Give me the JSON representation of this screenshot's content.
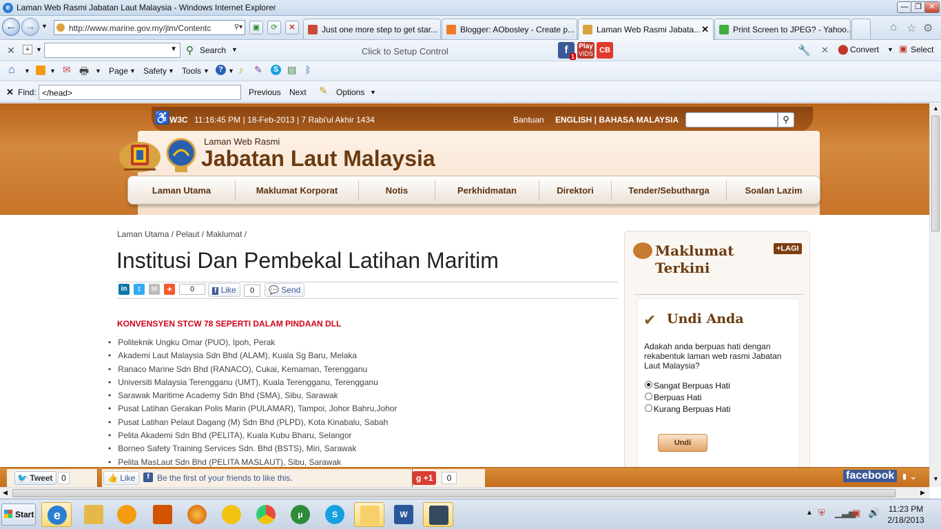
{
  "window": {
    "title": "Laman Web Rasmi Jabatan Laut Malaysia - Windows Internet Explorer"
  },
  "browser": {
    "url": "http://www.marine.gov.my/jlm/Contentc",
    "tabs": [
      {
        "label": "Just one more step to get star...",
        "color": "#c94a3a"
      },
      {
        "label": "Blogger: AObosley - Create p...",
        "color": "#f27b22"
      },
      {
        "label": "Laman Web Rasmi Jabata...",
        "color": "#d9a340"
      },
      {
        "label": "Print Screen to JPEG? - Yahoo...",
        "color": "#3fae3f"
      }
    ],
    "search_label": "Search",
    "utorrent": "uTorrent",
    "setup_control": "Click to Setup Control",
    "convert": "Convert",
    "select": "Select",
    "cmd": {
      "page": "Page",
      "safety": "Safety",
      "tools": "Tools"
    },
    "find": {
      "label": "Find:",
      "value": "</head>",
      "previous": "Previous",
      "next": "Next",
      "options": "Options"
    },
    "toolbar_badges": {
      "fb": "f",
      "fb_count": "1",
      "play": "Play",
      "vids": "VIDS",
      "cb": "CB"
    }
  },
  "site": {
    "topbar": {
      "w3c": "W3C",
      "datetime": "11:16:45 PM | 18-Feb-2013 | 7 Rabi'ul Akhir 1434",
      "help": "Bantuan",
      "lang": "ENGLISH | BAHASA MALAYSIA"
    },
    "logo_small": "Laman Web Rasmi",
    "logo_big": "Jabatan Laut Malaysia",
    "nav": [
      "Laman Utama",
      "Maklumat Korporat",
      "Notis",
      "Perkhidmatan",
      "Direktori",
      "Tender/Sebutharga",
      "Soalan Lazim"
    ],
    "breadcrumb": "Laman Utama / Pelaut / Maklumat /",
    "page_title": "Institusi Dan Pembekal Latihan Maritim",
    "share": {
      "count": "0",
      "like": "Like",
      "like_count": "0",
      "send": "Send"
    },
    "section_heading": "KONVENSYEN STCW 78 SEPERTI DALAM PINDAAN DLL",
    "institutions": [
      "Politeknik Ungku Omar (PUO), Ipoh, Perak",
      "Akademi Laut Malaysia Sdn Bhd (ALAM), Kuala Sg Baru, Melaka",
      "Ranaco Marine Sdn Bhd (RANACO), Cukai, Kemaman, Terengganu",
      "Universiti Malaysia Terengganu (UMT), Kuala Terengganu, Terengganu",
      "Sarawak Maritime Academy Sdn Bhd (SMA), Sibu, Sarawak",
      "Pusat Latihan Gerakan Polis Marin (PULAMAR), Tampoi, Johor Bahru,Johor",
      "Pusat Latihan Pelaut Dagang (M) Sdn Bhd (PLPD), Kota Kinabalu, Sabah",
      "Pelita Akademi Sdn Bhd (PELITA), Kuala Kubu Bharu, Selangor",
      "Borneo Safety Training Services Sdn. Bhd (BSTS), Miri, Sarawak",
      "Pelita MasLaut Sdn Bhd (PELITA MASLAUT), Sibu, Sarawak"
    ],
    "sidebar": {
      "news_title_1": "Maklumat",
      "news_title_2": "Terkini",
      "more": "+LAGI",
      "vote_title": "Undi Anda",
      "question": "Adakah anda berpuas hati dengan rekabentuk laman web rasmi Jabatan Laut Malaysia?",
      "options": [
        "Sangat Berpuas Hati",
        "Berpuas Hati",
        "Kurang Berpuas Hati"
      ],
      "selected": 0,
      "submit": "Undi"
    },
    "sharebar": {
      "tweet": "Tweet",
      "tweet_count": "0",
      "like": "Like",
      "fb_text": "Be the first of your friends to like this.",
      "gplus": "+1",
      "gplus_count": "0",
      "facebook": "facebook"
    }
  },
  "taskbar": {
    "start": "Start",
    "time": "11:23 PM",
    "date": "2/18/2013"
  }
}
